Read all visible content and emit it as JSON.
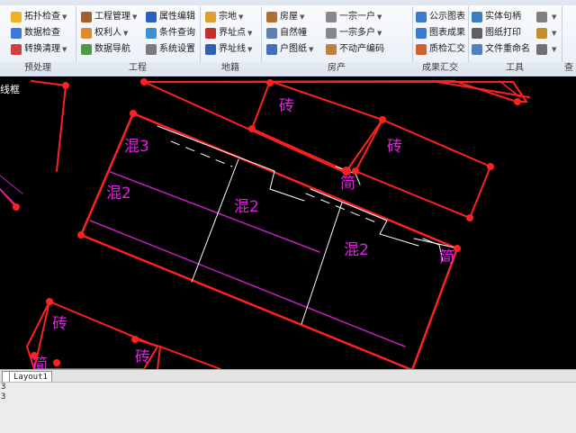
{
  "ribbon": {
    "groups": [
      {
        "label": "预处理",
        "buttons": [
          "拓扑检查",
          "数据检查",
          "转换清理"
        ]
      },
      {
        "label": "工程",
        "buttons": [
          "工程管理",
          "属性编辑",
          "权利人",
          "条件查询",
          "数据导航",
          "系统设置"
        ]
      },
      {
        "label": "地籍",
        "buttons": [
          "宗地",
          "界址点",
          "界址线"
        ]
      },
      {
        "label": "房产",
        "buttons": [
          "房屋",
          "一宗一户",
          "自然幢",
          "一宗多户",
          "户图纸",
          "不动产编码"
        ]
      },
      {
        "label": "成果汇交",
        "buttons": [
          "公示图表",
          "图表成果",
          "质检汇交"
        ]
      },
      {
        "label": "工具",
        "buttons": [
          "实体句柄",
          "图纸打印",
          "文件重命名"
        ]
      },
      {
        "label": "查"
      }
    ]
  },
  "canvas": {
    "labels": {
      "brick": "砖",
      "concrete2": "混2",
      "concrete3": "混3",
      "simple": "简",
      "tag": "线框"
    }
  },
  "layout": {
    "tab": "Layout1"
  },
  "command": {
    "lines": [
      "3",
      "3"
    ]
  },
  "colors": {
    "canvas_bg": "#000000",
    "parcel_line": "#ff2020",
    "label": "#e020e0",
    "inner_line": "#ffffff",
    "purple_line": "#c020c0"
  }
}
